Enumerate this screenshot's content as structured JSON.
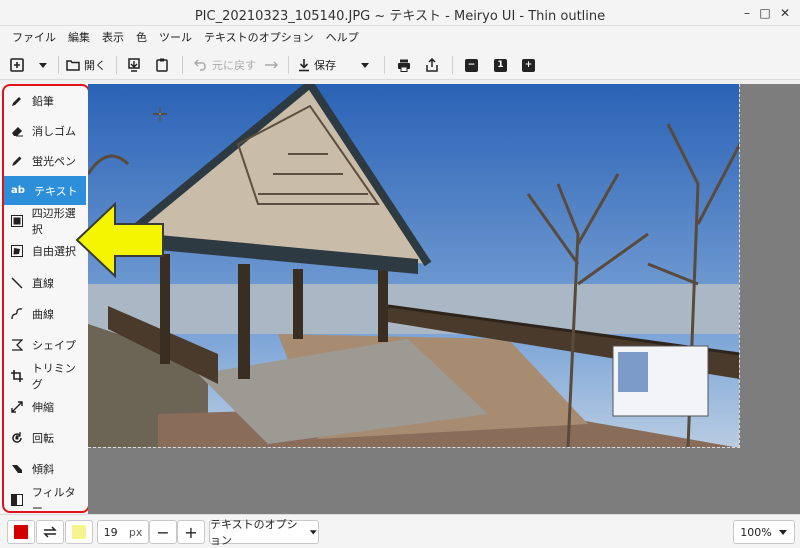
{
  "window": {
    "title": "PIC_20210323_105140.JPG ~ テキスト - Meiryo UI - Thin outline",
    "minimize": "–",
    "maximize": "□",
    "close": "✕"
  },
  "menu": [
    "ファイル",
    "編集",
    "表示",
    "色",
    "ツール",
    "テキストのオプション",
    "ヘルプ"
  ],
  "toolbar": {
    "open_label": "開く",
    "undo_label": "元に戻す",
    "save_label": "保存",
    "zoom_one_label": "1"
  },
  "tools": [
    {
      "label": "鉛筆",
      "icon": "pencil-icon"
    },
    {
      "label": "消しゴム",
      "icon": "eraser-icon"
    },
    {
      "label": "蛍光ペン",
      "icon": "highlighter-icon"
    },
    {
      "label": "テキスト",
      "icon": "text-icon",
      "active": true
    },
    {
      "label": "四辺形選択",
      "icon": "rect-select-icon"
    },
    {
      "label": "自由選択",
      "icon": "free-select-icon"
    },
    {
      "label": "直線",
      "icon": "line-icon"
    },
    {
      "label": "曲線",
      "icon": "curve-icon"
    },
    {
      "label": "シェイプ",
      "icon": "shape-icon"
    },
    {
      "label": "トリミング",
      "icon": "crop-icon"
    },
    {
      "label": "伸縮",
      "icon": "scale-icon"
    },
    {
      "label": "回転",
      "icon": "rotate-icon"
    },
    {
      "label": "傾斜",
      "icon": "skew-icon"
    },
    {
      "label": "フィルター",
      "icon": "filter-icon"
    }
  ],
  "text_tool_icon_glyph": "ab",
  "bottom": {
    "size_value": "19",
    "size_unit": "px",
    "minus": "−",
    "plus": "+",
    "text_options": "テキストのオプション",
    "zoom": "100%"
  },
  "colors": {
    "primary": "#d30000",
    "secondary": "#f6f48f",
    "accent": "#2d8fd9",
    "annotation_red": "#e0131a",
    "annotation_arrow": "#f5f500"
  }
}
